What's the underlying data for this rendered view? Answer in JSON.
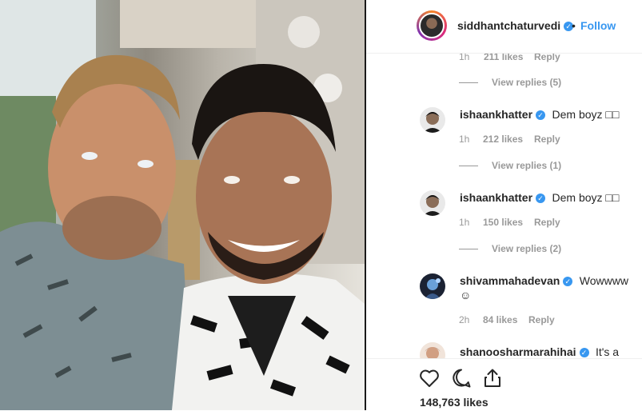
{
  "post": {
    "username": "siddhantchaturvedi",
    "separator": "•",
    "follow_label": "Follow",
    "likes_label": "148,763 likes"
  },
  "comments": [
    {
      "partial": true,
      "time": "1h",
      "likes": "211 likes",
      "reply": "Reply",
      "view_replies": "View replies (5)"
    },
    {
      "username": "ishaankhatter",
      "verified": true,
      "text": "Dem boyz □□",
      "time": "1h",
      "likes": "212 likes",
      "reply": "Reply",
      "view_replies": "View replies (1)"
    },
    {
      "username": "ishaankhatter",
      "verified": true,
      "text": "Dem boyz □□",
      "time": "1h",
      "likes": "150 likes",
      "reply": "Reply",
      "view_replies": "View replies (2)"
    },
    {
      "username": "shivammahadevan",
      "verified": true,
      "text": "Wowwww",
      "emoji": "☺",
      "time": "2h",
      "likes": "84 likes",
      "reply": "Reply"
    },
    {
      "username": "shanoosharmarahihai",
      "verified": true,
      "text": "It's a"
    }
  ],
  "icons": [
    "heart-icon",
    "comment-bubble-icon",
    "share-icon",
    "verified-badge-icon"
  ],
  "colors": {
    "link_blue": "#3897f0",
    "text": "#262626",
    "secondary": "#999999",
    "border": "#efefef"
  }
}
